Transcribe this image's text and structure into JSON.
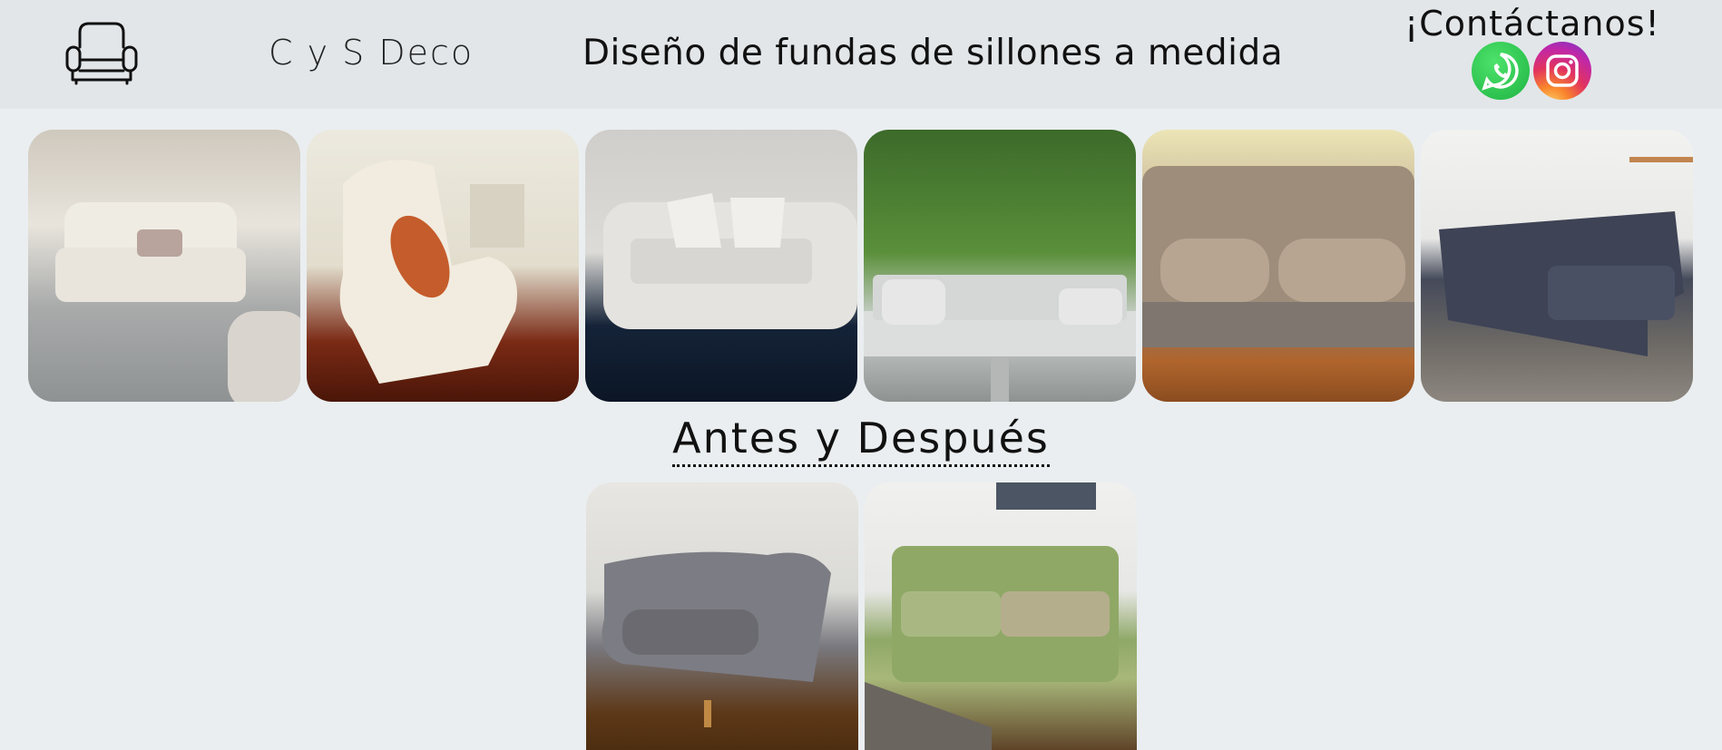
{
  "header": {
    "logo_icon": "armchair-icon",
    "brand": "C y S Deco",
    "tagline": "Diseño de fundas de sillones a medida",
    "contact_title": "¡Contáctanos!",
    "social": [
      {
        "name": "whatsapp",
        "icon": "whatsapp-icon",
        "color": "#25d366"
      },
      {
        "name": "instagram",
        "icon": "instagram-icon",
        "color": "#e2335e"
      }
    ]
  },
  "gallery": {
    "photos": [
      {
        "icon": "sofa-photo"
      },
      {
        "icon": "armchair-photo"
      },
      {
        "icon": "sofa-photo"
      },
      {
        "icon": "bench-photo"
      },
      {
        "icon": "sofa-photo"
      },
      {
        "icon": "sectional-sofa-photo"
      }
    ]
  },
  "before_after": {
    "title": "Antes y Después",
    "photos": [
      {
        "icon": "sofa-photo"
      },
      {
        "icon": "sofa-photo"
      }
    ]
  },
  "colors": {
    "header_bg": "#e2e6e9",
    "page_bg": "#eaeef0"
  }
}
